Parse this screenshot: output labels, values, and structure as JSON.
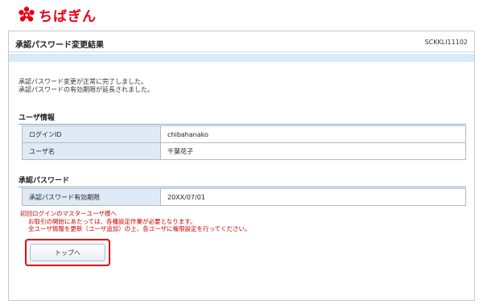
{
  "brand": {
    "name": "ちばぎん",
    "color": "#e60012",
    "icon": "chibagin-logo-icon"
  },
  "page": {
    "title": "承認パスワード変更結果",
    "screen_id": "SCKKLI11102"
  },
  "message": [
    "承認パスワード変更が正常に完了しました。",
    "承認パスワードの有効期限が延長されました。"
  ],
  "user_info": {
    "heading": "ユーザ情報",
    "rows": [
      {
        "label": "ログインID",
        "value": "chibahanako"
      },
      {
        "label": "ユーザ名",
        "value": "千葉花子"
      }
    ]
  },
  "approval_password": {
    "heading": "承認パスワード",
    "rows": [
      {
        "label": "承認パスワード有効期限",
        "value": "20XX/07/01"
      }
    ]
  },
  "notice": {
    "color": "#cc0000",
    "lines": [
      "初回ログインのマスターユーザ様へ",
      "お取引の開始にあたっては、各種設定作業が必要となります。",
      "全ユーザ情報を更新（ユーザ追加）の上、各ユーザに権限設定を行ってください。"
    ]
  },
  "buttons": {
    "top_label": "トップへ"
  }
}
